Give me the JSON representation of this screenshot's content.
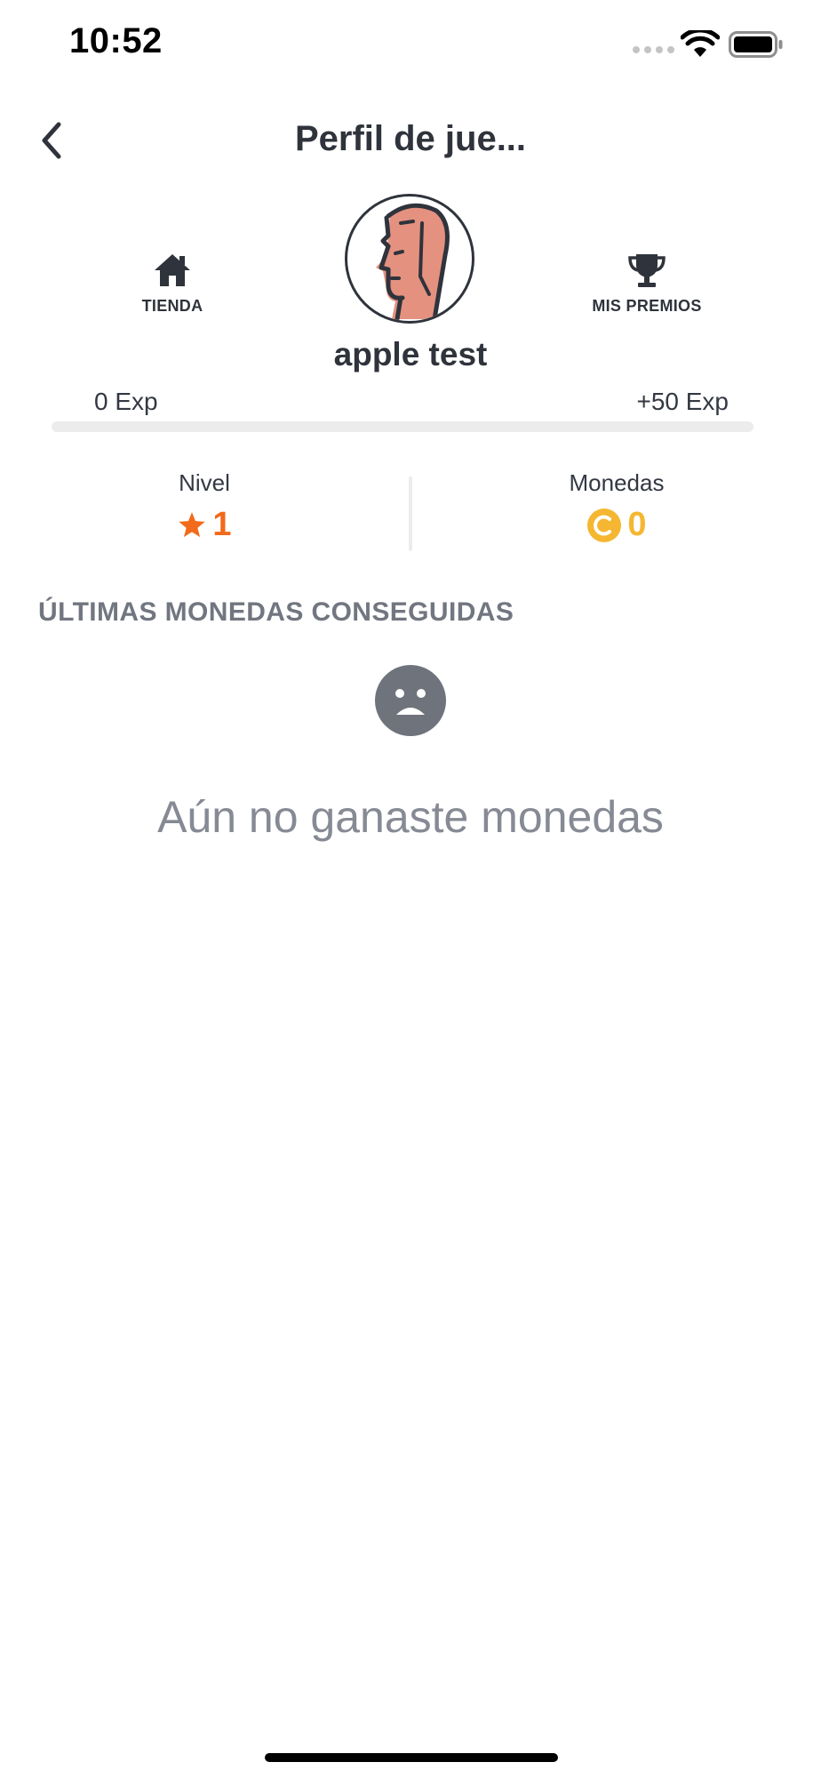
{
  "status_bar": {
    "time": "10:52"
  },
  "header": {
    "title": "Perfil de jue...",
    "back_icon": "chevron-left-icon"
  },
  "shortcuts": {
    "store": {
      "label": "TIENDA",
      "icon": "home-icon"
    },
    "prizes": {
      "label": "MIS PREMIOS",
      "icon": "trophy-icon"
    }
  },
  "profile": {
    "username": "apple test",
    "avatar_icon": "avatar-face-icon"
  },
  "experience": {
    "min_label": "0 Exp",
    "max_label": "+50 Exp",
    "progress_fraction": 0,
    "bar_color": "#f07a1a"
  },
  "stats": {
    "level": {
      "label": "Nivel",
      "value": "1",
      "icon": "star-icon",
      "color": "#f26a1b"
    },
    "coins": {
      "label": "Monedas",
      "value": "0",
      "icon": "coin-icon",
      "color": "#f5b731"
    }
  },
  "recent_coins": {
    "title": "ÚLTIMAS MONEDAS CONSEGUIDAS",
    "empty_icon": "sad-face-icon",
    "empty_message": "Aún no ganaste monedas"
  }
}
